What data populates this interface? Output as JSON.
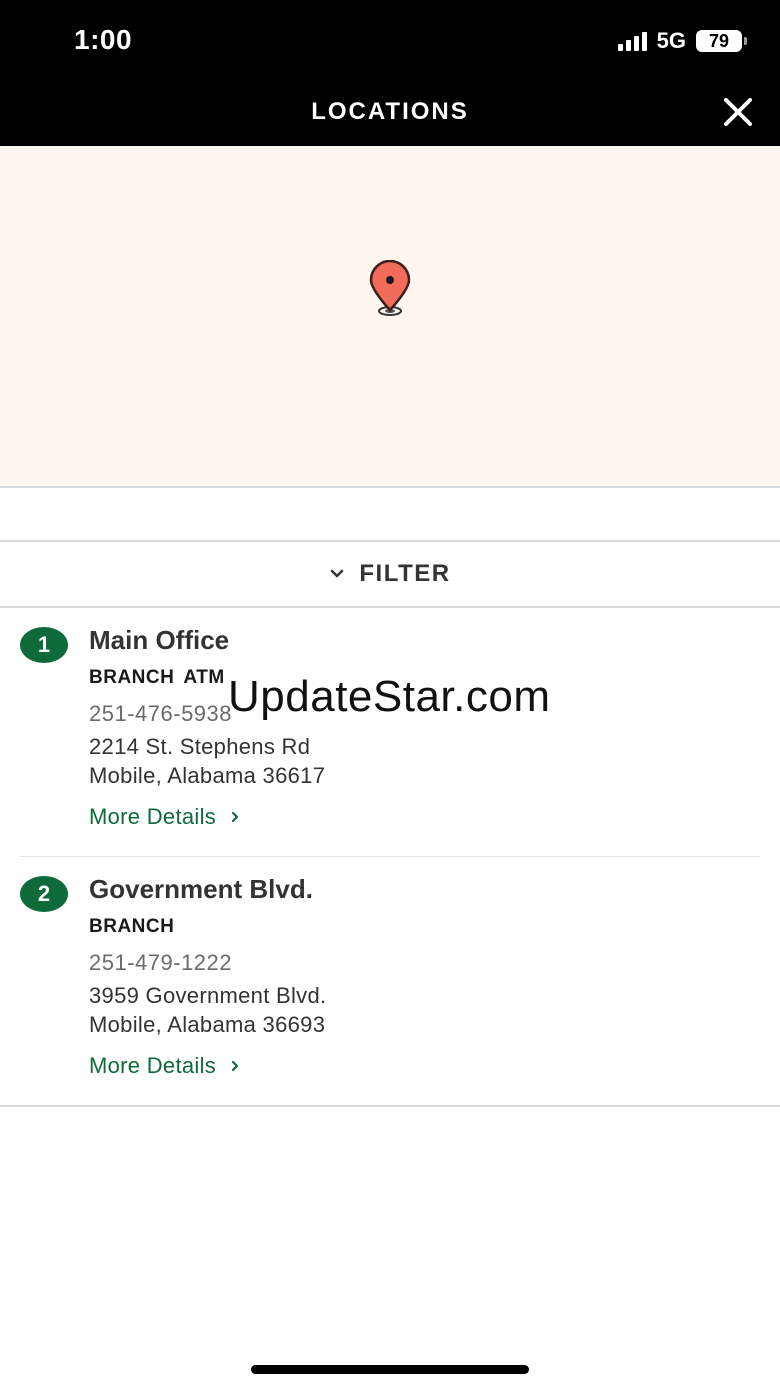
{
  "status_bar": {
    "time": "1:00",
    "network": "5G",
    "battery": "79"
  },
  "header": {
    "title": "LOCATIONS"
  },
  "filter": {
    "label": "FILTER"
  },
  "locations": [
    {
      "number": "1",
      "name": "Main Office",
      "types": "BRANCH ATM",
      "phone": "251-476-5938",
      "address_line1": "2214 St. Stephens Rd",
      "address_line2": "Mobile, Alabama 36617",
      "details_label": "More Details"
    },
    {
      "number": "2",
      "name": "Government Blvd.",
      "types": "BRANCH",
      "phone": "251-479-1222",
      "address_line1": "3959 Government Blvd.",
      "address_line2": "Mobile, Alabama 36693",
      "details_label": "More Details"
    }
  ],
  "watermark": "UpdateStar.com",
  "colors": {
    "accent_green": "#0e6a3a",
    "header_bg": "#000000",
    "map_bg": "#fff6f0",
    "pin_red": "#f26b5b"
  },
  "icons": {
    "close": "close-icon",
    "filter": "chevron-down-icon",
    "details": "chevron-right-icon",
    "pin": "map-pin-icon"
  }
}
